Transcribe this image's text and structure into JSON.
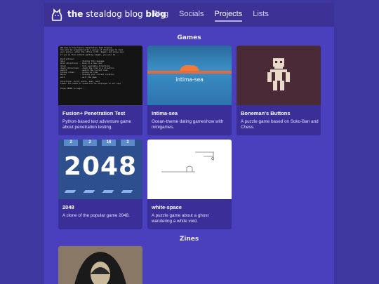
{
  "header": {
    "logo_icon": "dog-paw-icon",
    "title_bold": "the",
    "title_rest": "stealdog blog",
    "nav": [
      {
        "label": "Blog",
        "active": false
      },
      {
        "label": "Socials",
        "active": false
      },
      {
        "label": "Projects",
        "active": true
      },
      {
        "label": "Lists",
        "active": false
      }
    ]
  },
  "sections": {
    "games": "Games",
    "zines": "Zines"
  },
  "games": [
    {
      "title": "Fusion+ Penetration Test",
      "desc": "Python-based text adventure game about penetration testing."
    },
    {
      "title": "Intima-sea",
      "desc": "Ocean-theme dating gameshow with minigames.",
      "thumb_text": "intima-sea"
    },
    {
      "title": "Boneman's Buttons",
      "desc": "A puzzle game based on Soko-Ban and Chess."
    },
    {
      "title": "2048",
      "desc": "A clone of the popular game 2048.",
      "thumb_text": "2048",
      "tiles": [
        "2",
        "2",
        "16",
        "2"
      ]
    },
    {
      "title": "white-space",
      "desc": "A puzzle game about a ghost wandering a white void."
    }
  ],
  "terminal_lines": [
    "Welcome to the Fusion+ Penetration Test Program",
    "You will be presented with a series of challenges to test",
    "your skills: enter the office of Mr. Rogers and prove your",
    "If you do this without getting caught, you will be ...",
    "",
    "Instructions:",
    "help              - display this message",
    "move <direction>  - move in a new room",
    "check             - list available directions",
    "check <direction> - check the room in a direction",
    "search            - search the current room",
    "pickup <item>     - pickup an item",
    "where             - display your current location",
    "exit              - exit the game",
    "",
    "Directions: north, south, east, west",
    "Items: The names of items will be displayed in all caps",
    "",
    "Press ENTER to begin..."
  ],
  "colors": {
    "background": "#3f37a0",
    "page": "#4a3fbd",
    "header": "#3c3295",
    "card": "#3a2f98"
  }
}
